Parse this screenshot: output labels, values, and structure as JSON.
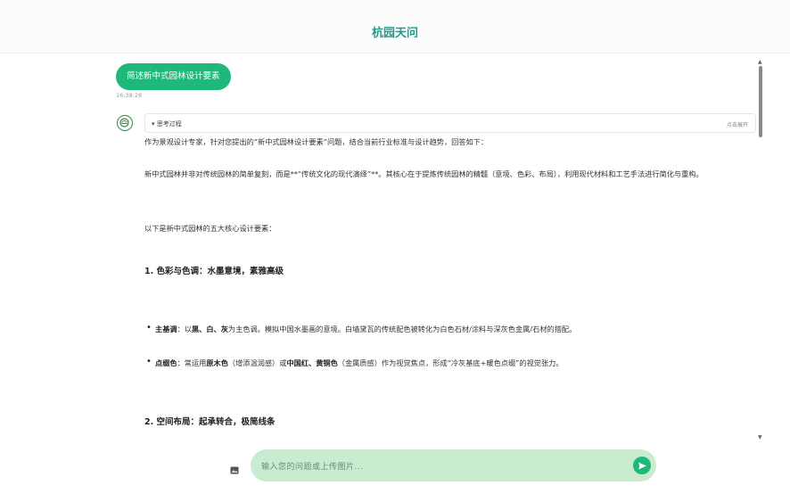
{
  "header": {
    "title": "杭园天问"
  },
  "user_message": {
    "text": "简述新中式园林设计要素",
    "time": "16:38:28"
  },
  "thinking": {
    "label": "思考过程",
    "expand_label": "点击展开"
  },
  "answer": {
    "intro": "作为景观设计专家，针对您提出的“新中式园林设计要素”问题，结合当前行业标准与设计趋势，回答如下：",
    "p1": "新中式园林并非对传统园林的简单复刻，而是**“传统文化的现代演绎”**。其核心在于提炼传统园林的精髓（意境、色彩、布局），利用现代材料和工艺手法进行简化与重构。",
    "p2": "以下是新中式园林的五大核心设计要素：",
    "section1": "1. 色彩与色调：水墨意境，素雅高级",
    "b1": {
      "label": "主基调",
      "sep": "：以",
      "c1": "黑、白、灰",
      "rest": "为主色调。模拟中国水墨画的意境。白墙黛瓦的传统配色被转化为白色石材/涂料与深灰色金属/石材的搭配。"
    },
    "b2": {
      "label": "点缀色",
      "pre": "：常运用",
      "c1": "原木色",
      "m1": "（增添温润感）或",
      "c2": "中国红、黄铜色",
      "rest": "（金属质感）作为视觉焦点，形成“冷灰基底+暖色点缀”的视觉张力。"
    },
    "section2": "2. 空间布局：起承转合，极简线条"
  },
  "input": {
    "placeholder": "输入您的问题或上传图片..."
  },
  "colors": {
    "accent": "#1db87a",
    "title": "#1f9c8c",
    "input_bg": "#c9ebcf"
  },
  "icons": {
    "avatar": "garden-logo-icon",
    "image": "image-upload-icon",
    "send": "send-icon",
    "caret": "caret-down-icon"
  }
}
